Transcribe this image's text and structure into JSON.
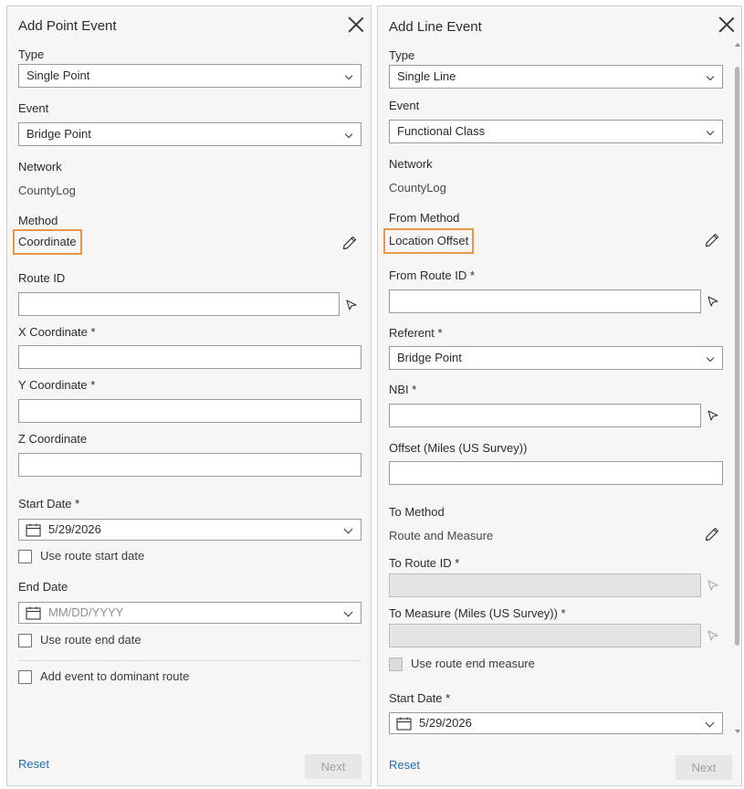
{
  "left": {
    "title": "Add Point Event",
    "type_label": "Type",
    "type_value": "Single Point",
    "event_label": "Event",
    "event_value": "Bridge Point",
    "network_label": "Network",
    "network_value": "CountyLog",
    "method_label": "Method",
    "method_value": "Coordinate",
    "route_id_label": "Route ID",
    "x_label": "X Coordinate *",
    "y_label": "Y Coordinate *",
    "z_label": "Z Coordinate",
    "start_date_label": "Start Date *",
    "start_date_value": "5/29/2026",
    "use_route_start_label": "Use route start date",
    "end_date_label": "End Date",
    "end_date_placeholder": "MM/DD/YYYY",
    "use_route_end_label": "Use route end date",
    "dominant_route_label": "Add event to dominant route",
    "reset_label": "Reset",
    "next_label": "Next"
  },
  "right": {
    "title": "Add Line Event",
    "type_label": "Type",
    "type_value": "Single Line",
    "event_label": "Event",
    "event_value": "Functional Class",
    "network_label": "Network",
    "network_value": "CountyLog",
    "from_method_label": "From Method",
    "from_method_value": "Location Offset",
    "from_route_id_label": "From Route ID *",
    "referent_label": "Referent *",
    "referent_value": "Bridge Point",
    "nbi_label": "NBI *",
    "offset_label": "Offset (Miles (US Survey))",
    "to_method_label": "To Method",
    "to_method_value": "Route and Measure",
    "to_route_id_label": "To Route ID *",
    "to_measure_label": "To Measure (Miles (US Survey)) *",
    "use_route_end_measure_label": "Use route end measure",
    "start_date_label": "Start Date *",
    "start_date_value": "5/29/2026",
    "reset_label": "Reset",
    "next_label": "Next"
  },
  "colors": {
    "highlight": "#e8964a",
    "link": "#1d6fb8",
    "panel_bg": "#f8f6f5"
  }
}
